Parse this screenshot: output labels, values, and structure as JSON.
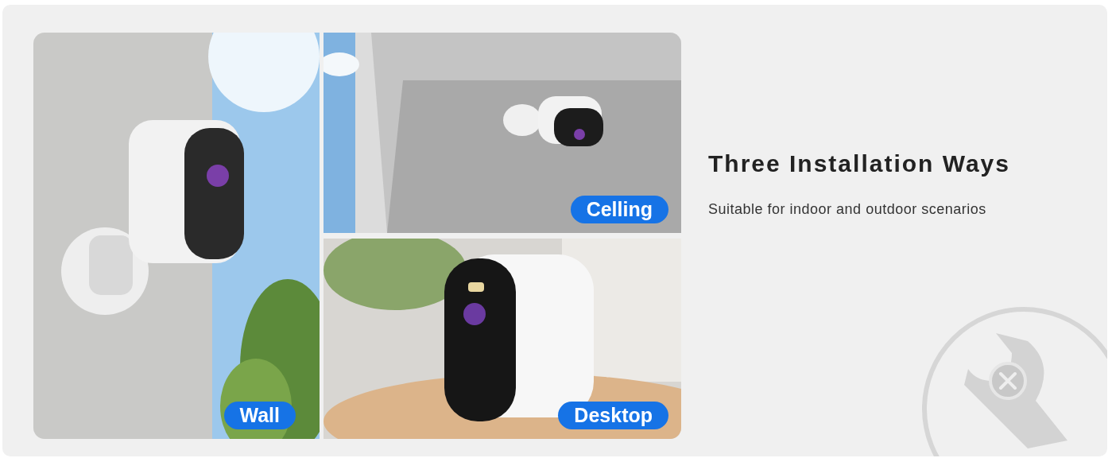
{
  "photos": [
    {
      "label": "Wall"
    },
    {
      "label": "Celling"
    },
    {
      "label": "Desktop"
    }
  ],
  "heading": "Three Installation Ways",
  "subtitle": "Suitable for indoor and outdoor scenarios"
}
